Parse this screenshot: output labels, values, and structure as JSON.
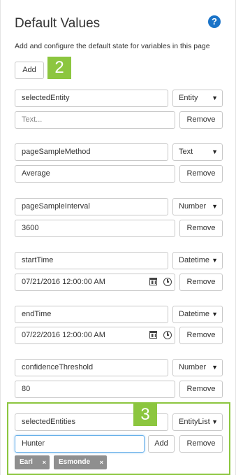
{
  "header": {
    "title": "Default Values",
    "help_symbol": "?"
  },
  "subtitle": "Add and configure the default state for variables in this page",
  "add_label": "Add",
  "remove_label": "Remove",
  "callouts": {
    "two": "2",
    "three": "3"
  },
  "variables": [
    {
      "name": "selectedEntity",
      "type": "Entity",
      "value": "",
      "placeholder": "Text..."
    },
    {
      "name": "pageSampleMethod",
      "type": "Text",
      "value": "Average"
    },
    {
      "name": "pageSampleInterval",
      "type": "Number",
      "value": "3600"
    },
    {
      "name": "startTime",
      "type": "Datetime",
      "value": "07/21/2016 12:00:00 AM"
    },
    {
      "name": "endTime",
      "type": "Datetime",
      "value": "07/22/2016 12:00:00 AM"
    },
    {
      "name": "confidenceThreshold",
      "type": "Number",
      "value": "80"
    },
    {
      "name": "selectedEntities",
      "type": "EntityList",
      "value": "Hunter",
      "tags": [
        "Earl",
        "Esmonde"
      ]
    }
  ],
  "tag_remove_symbol": "×",
  "caret_symbol": "▼",
  "colors": {
    "accent_green": "#8cc63f",
    "help_blue": "#1a73c8",
    "tag_grey": "#8f8f8f"
  }
}
